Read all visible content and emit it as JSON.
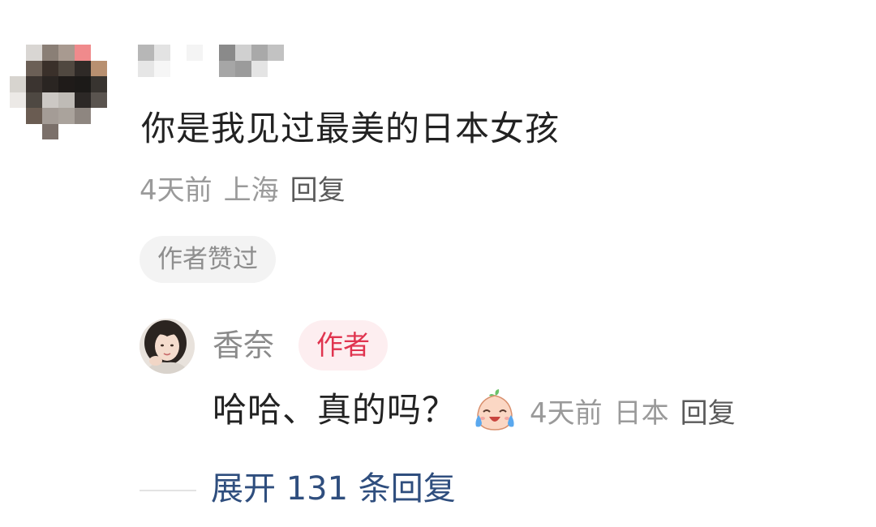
{
  "comment": {
    "avatar": "pixelated-avatar",
    "username": "",
    "text": "你是我见过最美的日本女孩",
    "time": "4天前",
    "location": "上海",
    "reply_label": "回复",
    "liked_tag": "作者赞过"
  },
  "author_reply": {
    "avatar": "author-avatar-photo",
    "name": "香奈",
    "badge": "作者",
    "text": "哈哈、真的吗？",
    "emoji": "crying-laughing-emoji",
    "time": "4天前",
    "location": "日本",
    "reply_label": "回复"
  },
  "expand": {
    "label": "展开 131 条回复"
  },
  "colors": {
    "text_primary": "#222222",
    "text_meta": "#9a9a9a",
    "badge_text": "#e0344f",
    "badge_bg": "#fdeef0",
    "link": "#2f4e7e",
    "tag_bg": "#f3f3f3"
  }
}
